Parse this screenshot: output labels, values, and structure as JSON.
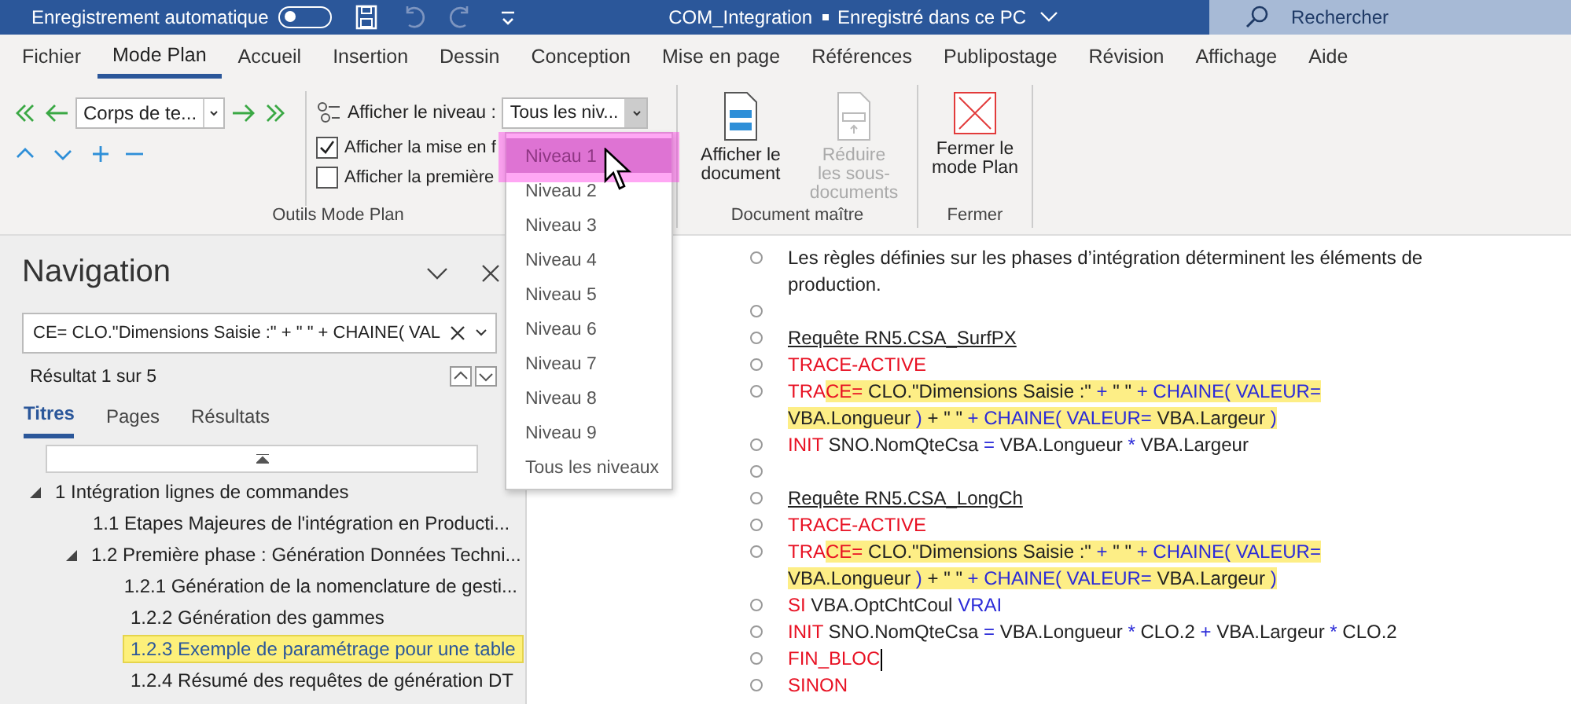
{
  "title_bar": {
    "autosave_label": "Enregistrement automatique",
    "autosave_on": false,
    "document_title": "COM_Integration",
    "save_status": "Enregistré dans ce PC",
    "search_placeholder": "Rechercher"
  },
  "ribbon_tabs": [
    {
      "label": "Fichier",
      "selected": false
    },
    {
      "label": "Mode Plan",
      "selected": true
    },
    {
      "label": "Accueil",
      "selected": false
    },
    {
      "label": "Insertion",
      "selected": false
    },
    {
      "label": "Dessin",
      "selected": false
    },
    {
      "label": "Conception",
      "selected": false
    },
    {
      "label": "Mise en page",
      "selected": false
    },
    {
      "label": "Références",
      "selected": false
    },
    {
      "label": "Publipostage",
      "selected": false
    },
    {
      "label": "Révision",
      "selected": false
    },
    {
      "label": "Affichage",
      "selected": false
    },
    {
      "label": "Aide",
      "selected": false
    }
  ],
  "outline_tools": {
    "level_combo": "Corps de te...",
    "show_level_label": "Afficher le niveau :",
    "show_level_value": "Tous les niv...",
    "show_formatting": {
      "label": "Afficher la mise en f",
      "checked": true
    },
    "show_first_line": {
      "label": "Afficher la première",
      "checked": false
    },
    "group_label": "Outils Mode Plan"
  },
  "master_document": {
    "show_document": {
      "label": "Afficher le document",
      "disabled": false
    },
    "collapse_subdocuments": {
      "label": "Réduire les sous-documents",
      "disabled": true
    },
    "group_label": "Document maître"
  },
  "close_group": {
    "button": "Fermer le mode Plan",
    "group_label": "Fermer"
  },
  "level_dropdown": [
    {
      "label": "Niveau 1",
      "selected": true
    },
    {
      "label": "Niveau 2",
      "selected": false
    },
    {
      "label": "Niveau 3",
      "selected": false
    },
    {
      "label": "Niveau 4",
      "selected": false
    },
    {
      "label": "Niveau 5",
      "selected": false
    },
    {
      "label": "Niveau 6",
      "selected": false
    },
    {
      "label": "Niveau 7",
      "selected": false
    },
    {
      "label": "Niveau 8",
      "selected": false
    },
    {
      "label": "Niveau 9",
      "selected": false
    },
    {
      "label": "Tous les niveaux",
      "selected": false
    }
  ],
  "navigation": {
    "title": "Navigation",
    "search_value": "CE= CLO.\"Dimensions Saisie :\" + \" \" + CHAINE( VAL",
    "result_count": "Résultat 1 sur 5",
    "tabs": [
      {
        "label": "Titres",
        "selected": true
      },
      {
        "label": "Pages",
        "selected": false
      },
      {
        "label": "Résultats",
        "selected": false
      }
    ],
    "tree": [
      {
        "label": "1 Intégration lignes de commandes",
        "expanded": true,
        "selected": false,
        "children": [
          {
            "label": "1.1 Etapes Majeures de l'intégration en Producti...",
            "selected": false
          },
          {
            "label": "1.2 Première phase : Génération Données Techni...",
            "expanded": true,
            "selected": false,
            "children": [
              {
                "label": "1.2.1 Génération de la nomenclature de gesti...",
                "selected": false
              },
              {
                "label": "1.2.2 Génération des gammes",
                "selected": false
              },
              {
                "label": "1.2.3 Exemple de paramétrage pour une table",
                "selected": true
              },
              {
                "label": "1.2.4 Résumé des requêtes de génération DT",
                "selected": false
              }
            ]
          }
        ]
      }
    ]
  },
  "document": [
    {
      "kind": "text",
      "segments": [
        {
          "text": "Les règles définies sur les phases d’intégration déterminent les éléments de production.",
          "kind": "plain",
          "highlighted": false
        }
      ]
    },
    {
      "kind": "empty"
    },
    {
      "kind": "heading",
      "segments": [
        {
          "text": "Requête RN5.CSA_SurfPX",
          "kind": "plain",
          "highlighted": false
        }
      ]
    },
    {
      "kind": "text",
      "segments": [
        {
          "text": "TRACE-ACTIVE",
          "kind": "keyword",
          "highlighted": false
        }
      ]
    },
    {
      "kind": "text",
      "segments": [
        {
          "text": "TRA",
          "kind": "keyword",
          "highlighted": false
        },
        {
          "text": "CE=",
          "kind": "keyword",
          "highlighted": true
        },
        {
          "text": " CLO.\"Dimensions Saisie :\" ",
          "kind": "plain",
          "highlighted": true
        },
        {
          "text": "+",
          "kind": "operator",
          "highlighted": true
        },
        {
          "text": " \" \" ",
          "kind": "plain",
          "highlighted": true
        },
        {
          "text": "+ CHAINE( VALEUR=",
          "kind": "operator",
          "highlighted": true
        },
        {
          "text": " VBA.Longueur ",
          "kind": "plain",
          "highlighted": true
        },
        {
          "text": ")",
          "kind": "operator",
          "highlighted": true
        },
        {
          "text": " + ",
          "kind": "plain",
          "highlighted": true
        },
        {
          "text": "\" \" ",
          "kind": "plain",
          "highlighted": true
        },
        {
          "text": "+ CHAINE( VALEUR=",
          "kind": "operator",
          "highlighted": true
        },
        {
          "text": " VBA.Largeur ",
          "kind": "plain",
          "highlighted": true
        },
        {
          "text": ")",
          "kind": "operator",
          "highlighted": true
        }
      ]
    },
    {
      "kind": "text",
      "segments": [
        {
          "text": "INIT",
          "kind": "keyword",
          "highlighted": false
        },
        {
          "text": " SNO.NomQteCsa ",
          "kind": "plain",
          "highlighted": false
        },
        {
          "text": "=",
          "kind": "operator",
          "highlighted": false
        },
        {
          "text": " VBA.Longueur ",
          "kind": "plain",
          "highlighted": false
        },
        {
          "text": "*",
          "kind": "operator",
          "highlighted": false
        },
        {
          "text": " VBA.Largeur",
          "kind": "plain",
          "highlighted": false
        }
      ]
    },
    {
      "kind": "empty"
    },
    {
      "kind": "heading",
      "segments": [
        {
          "text": "Requête RN5.CSA_LongCh",
          "kind": "plain",
          "highlighted": false
        }
      ]
    },
    {
      "kind": "text",
      "segments": [
        {
          "text": "TRACE-ACTIVE",
          "kind": "keyword",
          "highlighted": false
        }
      ]
    },
    {
      "kind": "text",
      "segments": [
        {
          "text": "TRA",
          "kind": "keyword",
          "highlighted": false
        },
        {
          "text": "CE=",
          "kind": "keyword",
          "highlighted": true
        },
        {
          "text": " CLO.\"Dimensions Saisie :\" ",
          "kind": "plain",
          "highlighted": true
        },
        {
          "text": "+",
          "kind": "operator",
          "highlighted": true
        },
        {
          "text": " \" \" ",
          "kind": "plain",
          "highlighted": true
        },
        {
          "text": "+ CHAINE( VALEUR=",
          "kind": "operator",
          "highlighted": true
        },
        {
          "text": " VBA.Longueur ",
          "kind": "plain",
          "highlighted": true
        },
        {
          "text": ")",
          "kind": "operator",
          "highlighted": true
        },
        {
          "text": " + ",
          "kind": "plain",
          "highlighted": true
        },
        {
          "text": "\" \" ",
          "kind": "plain",
          "highlighted": true
        },
        {
          "text": "+ CHAINE( VALEUR=",
          "kind": "operator",
          "highlighted": true
        },
        {
          "text": " VBA.Largeur ",
          "kind": "plain",
          "highlighted": true
        },
        {
          "text": ")",
          "kind": "operator",
          "highlighted": true
        }
      ]
    },
    {
      "kind": "text",
      "segments": [
        {
          "text": "SI",
          "kind": "keyword",
          "highlighted": false
        },
        {
          "text": " VBA.OptChtCoul ",
          "kind": "plain",
          "highlighted": false
        },
        {
          "text": "VRAI",
          "kind": "operator",
          "highlighted": false
        }
      ]
    },
    {
      "kind": "text",
      "segments": [
        {
          "text": "INIT",
          "kind": "keyword",
          "highlighted": false
        },
        {
          "text": " SNO.NomQteCsa ",
          "kind": "plain",
          "highlighted": false
        },
        {
          "text": "=",
          "kind": "operator",
          "highlighted": false
        },
        {
          "text": " VBA.Longueur ",
          "kind": "plain",
          "highlighted": false
        },
        {
          "text": "*",
          "kind": "operator",
          "highlighted": false
        },
        {
          "text": " CLO.2 ",
          "kind": "plain",
          "highlighted": false
        },
        {
          "text": "+",
          "kind": "operator",
          "highlighted": false
        },
        {
          "text": " VBA.Largeur ",
          "kind": "plain",
          "highlighted": false
        },
        {
          "text": "*",
          "kind": "operator",
          "highlighted": false
        },
        {
          "text": " CLO.2",
          "kind": "plain",
          "highlighted": false
        }
      ]
    },
    {
      "kind": "text",
      "caret": true,
      "segments": [
        {
          "text": "FIN_BLOC",
          "kind": "keyword",
          "highlighted": false
        }
      ]
    },
    {
      "kind": "text",
      "segments": [
        {
          "text": "SINON",
          "kind": "keyword",
          "highlighted": false
        }
      ]
    }
  ]
}
